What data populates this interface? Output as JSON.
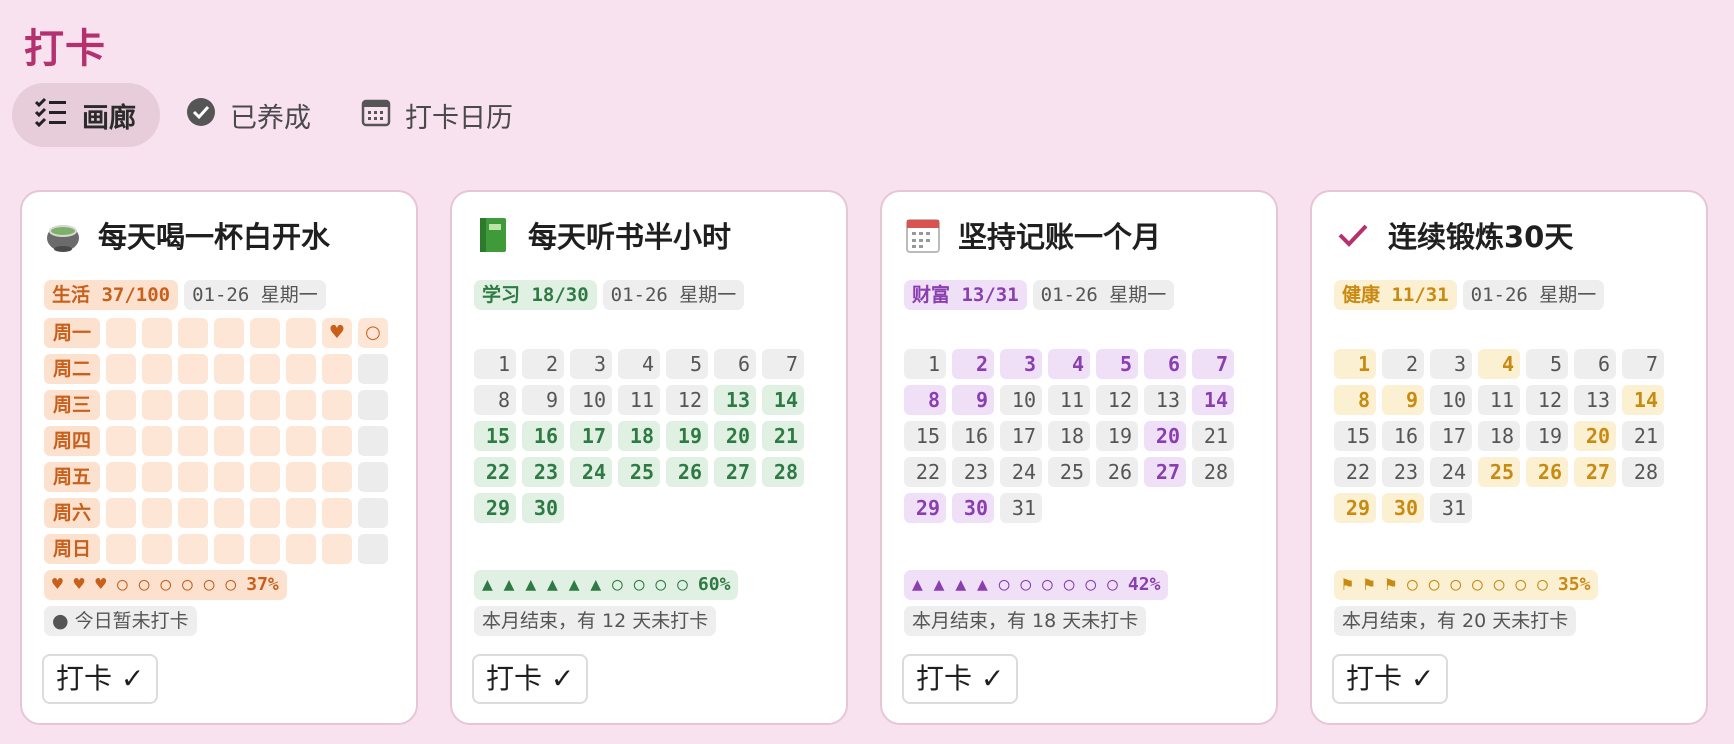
{
  "page": {
    "title": "打卡"
  },
  "tabs": [
    {
      "label": "画廊",
      "icon": "list-check-icon",
      "active": true
    },
    {
      "label": "已养成",
      "icon": "check-circle-icon",
      "active": false
    },
    {
      "label": "打卡日历",
      "icon": "calendar-icon",
      "active": false
    }
  ],
  "cards": [
    {
      "id": "water",
      "icon": "teacup-icon",
      "title": "每天喝一杯白开水",
      "category": "生活 37/100",
      "date": "01-26 星期一",
      "color": "#c8601c",
      "bg": "#fde1cf",
      "weekdays": [
        "周一",
        "周二",
        "周三",
        "周四",
        "周五",
        "周六",
        "周日"
      ],
      "week_marks": {
        "row0_col6": "♥",
        "row0_col7": "○"
      },
      "progress": "♥ ♥ ♥ ○ ○ ○ ○ ○ ○",
      "percent": "37%",
      "status": "● 今日暂未打卡",
      "button": "打卡 ✓"
    },
    {
      "id": "book",
      "icon": "green-book-icon",
      "title": "每天听书半小时",
      "category": "学习 18/30",
      "date": "01-26 星期一",
      "color": "#2f7a44",
      "bg": "#e0f1e4",
      "checked_days": [
        13,
        14,
        15,
        16,
        17,
        18,
        19,
        20,
        21,
        22,
        23,
        24,
        25,
        26,
        27,
        28,
        29,
        30
      ],
      "days_in_month": 30,
      "progress": "▲ ▲ ▲ ▲ ▲ ▲ ○ ○ ○ ○",
      "percent": "60%",
      "status": "本月结束，有 12 天未打卡",
      "button": "打卡 ✓"
    },
    {
      "id": "ledger",
      "icon": "tear-off-calendar-icon",
      "title": "坚持记账一个月",
      "category": "财富 13/31",
      "date": "01-26 星期一",
      "color": "#8a3fb0",
      "bg": "#f0e0f7",
      "checked_days": [
        2,
        3,
        4,
        5,
        6,
        7,
        8,
        9,
        14,
        20,
        27,
        29,
        30
      ],
      "days_in_month": 31,
      "progress": "▲ ▲ ▲ ▲ ○ ○ ○ ○ ○ ○",
      "percent": "42%",
      "status": "本月结束，有 18 天未打卡",
      "button": "打卡 ✓"
    },
    {
      "id": "exercise",
      "icon": "checkmark-icon",
      "title": "连续锻炼30天",
      "category": "健康 11/31",
      "date": "01-26 星期一",
      "color": "#c98a12",
      "bg": "#fbf0d2",
      "checked_days": [
        1,
        4,
        8,
        9,
        14,
        20,
        25,
        26,
        27,
        29,
        30
      ],
      "days_in_month": 31,
      "progress": "⚑ ⚑ ⚑ ○ ○ ○ ○ ○ ○ ○",
      "percent": "35%",
      "status": "本月结束，有 20 天未打卡",
      "button": "打卡 ✓"
    }
  ]
}
